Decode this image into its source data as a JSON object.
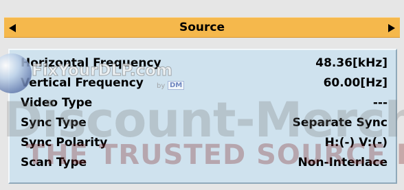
{
  "menu": {
    "title": "Source",
    "prev_icon": "triangle-left-icon",
    "next_icon": "triangle-right-icon"
  },
  "rows": [
    {
      "label": "Horizontal Frequency",
      "value": "48.36[kHz]"
    },
    {
      "label": "Vertical Frequency",
      "value": "60.00[Hz]"
    },
    {
      "label": "Video Type",
      "value": "---"
    },
    {
      "label": "Sync Type",
      "value": "Separate Sync"
    },
    {
      "label": "Sync Polarity",
      "value": "H:(-) V:(-)"
    },
    {
      "label": "Scan Type",
      "value": "Non-Interlace"
    }
  ],
  "watermark": {
    "fix": "FixYourDLP.com",
    "by": "by",
    "dm": "DM",
    "discount": "Discount-Merchant",
    "trusted": "THE TRUSTED SOURCE FOR PROJECTOR LAMPS"
  },
  "colors": {
    "header": "#f5b84c",
    "panel": "#cfe2ee",
    "frame": "#e6e6e6"
  }
}
